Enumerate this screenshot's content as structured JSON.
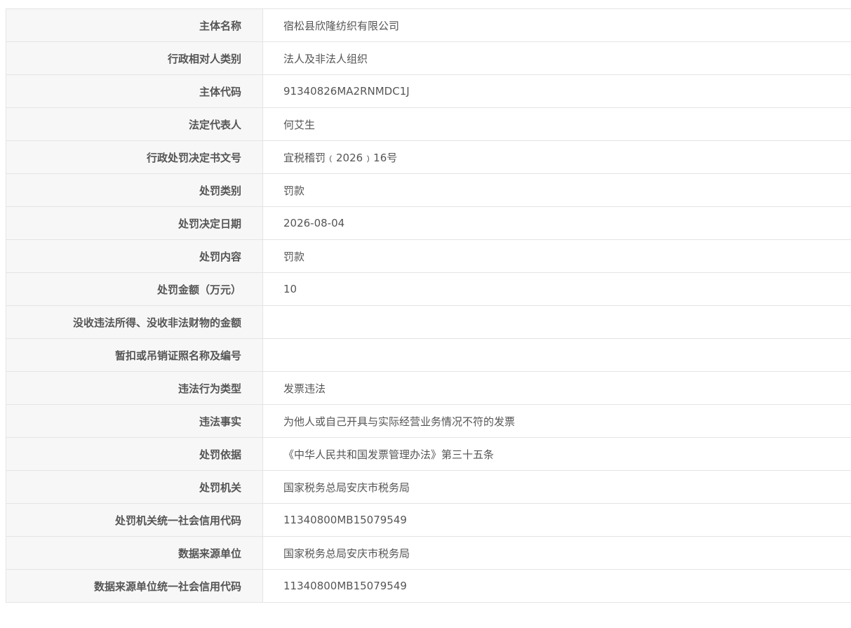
{
  "rows": [
    {
      "label": "主体名称",
      "value": "宿松县欣隆纺织有限公司"
    },
    {
      "label": "行政相对人类别",
      "value": "法人及非法人组织"
    },
    {
      "label": "主体代码",
      "value": "91340826MA2RNMDC1J"
    },
    {
      "label": "法定代表人",
      "value": "何艾生"
    },
    {
      "label": "行政处罚决定书文号",
      "value": "宜税稽罚﹙2026﹚16号"
    },
    {
      "label": "处罚类别",
      "value": "罚款"
    },
    {
      "label": "处罚决定日期",
      "value": "2026-08-04"
    },
    {
      "label": "处罚内容",
      "value": "罚款"
    },
    {
      "label": "处罚金额（万元）",
      "value": "10"
    },
    {
      "label": "没收违法所得、没收非法财物的金额",
      "value": ""
    },
    {
      "label": "暂扣或吊销证照名称及编号",
      "value": ""
    },
    {
      "label": "违法行为类型",
      "value": "发票违法"
    },
    {
      "label": "违法事实",
      "value": "为他人或自己开具与实际经营业务情况不符的发票"
    },
    {
      "label": "处罚依据",
      "value": "《中华人民共和国发票管理办法》第三十五条"
    },
    {
      "label": "处罚机关",
      "value": "国家税务总局安庆市税务局"
    },
    {
      "label": "处罚机关统一社会信用代码",
      "value": "11340800MB15079549"
    },
    {
      "label": "数据来源单位",
      "value": "国家税务总局安庆市税务局"
    },
    {
      "label": "数据来源单位统一社会信用代码",
      "value": "11340800MB15079549"
    }
  ]
}
